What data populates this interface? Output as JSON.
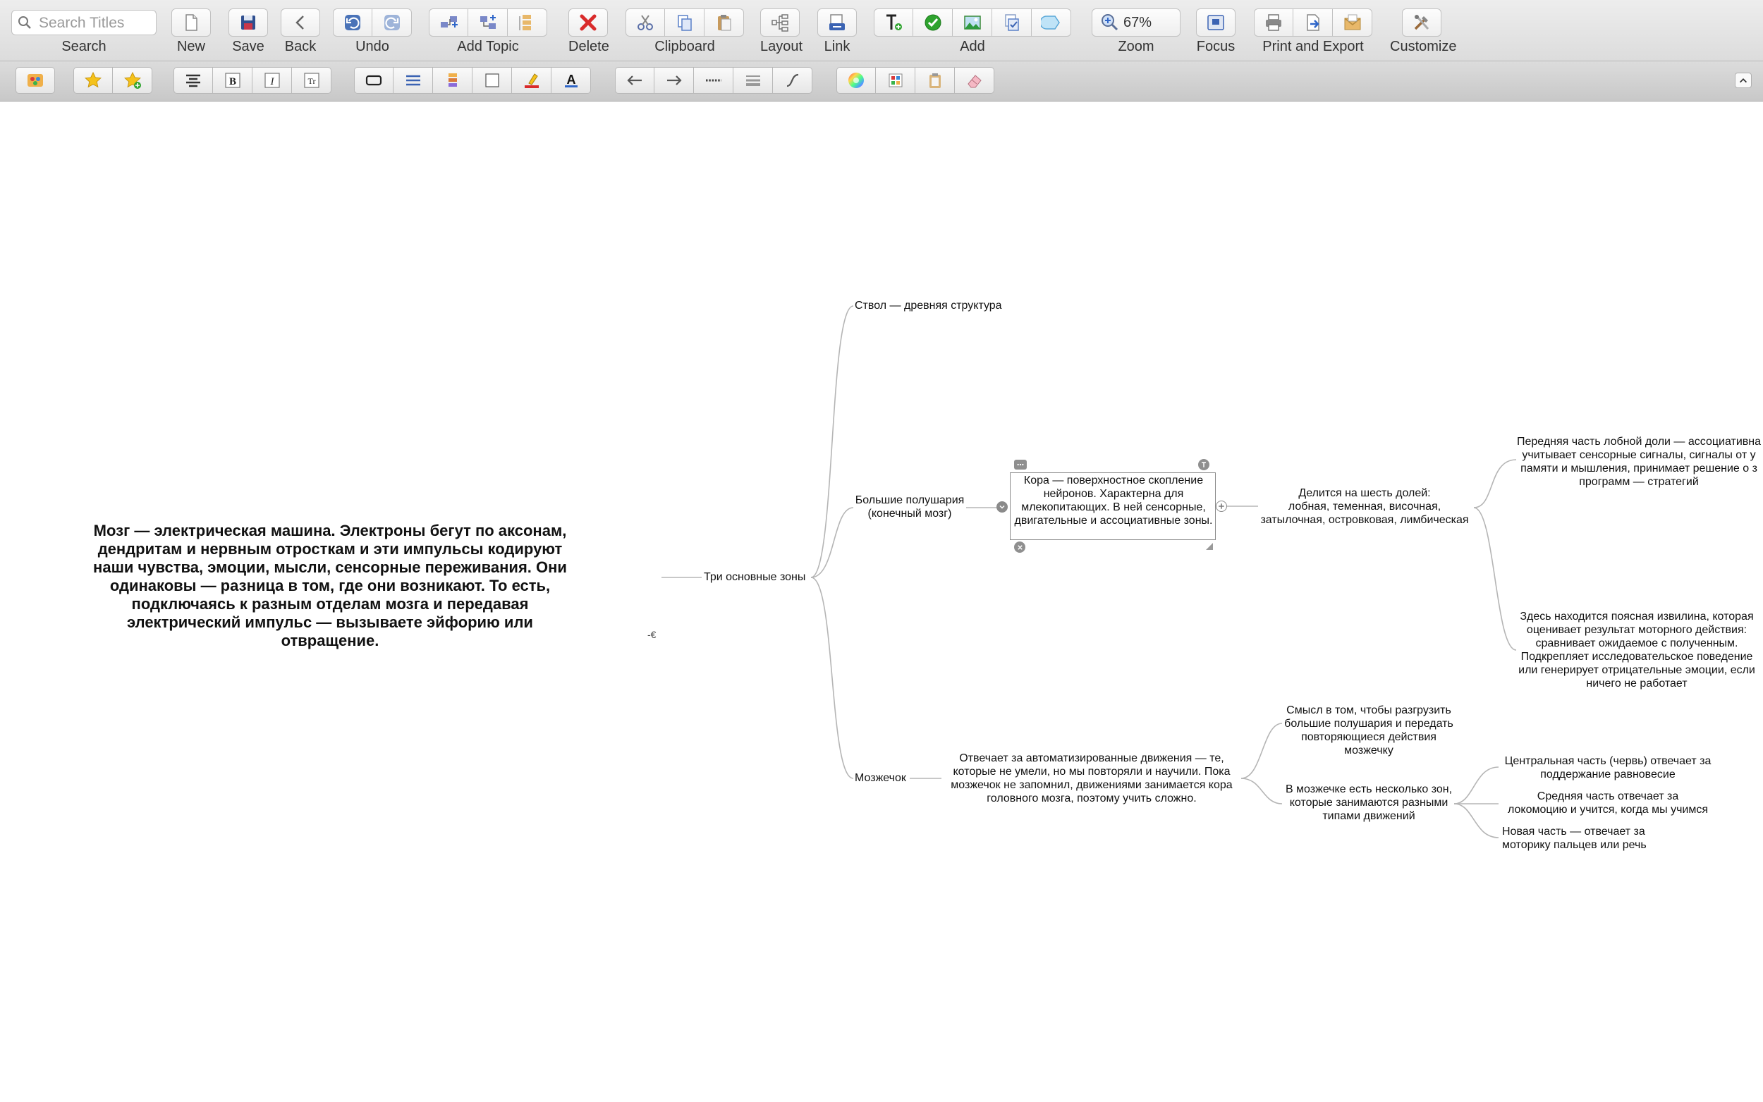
{
  "toolbar": {
    "search_placeholder": "Search Titles",
    "labels": {
      "search": "Search",
      "new": "New",
      "save": "Save",
      "back": "Back",
      "undo": "Undo",
      "add_topic": "Add Topic",
      "delete": "Delete",
      "clipboard": "Clipboard",
      "layout": "Layout",
      "link": "Link",
      "add": "Add",
      "zoom": "Zoom",
      "focus": "Focus",
      "print_export": "Print and Export",
      "customize": "Customize"
    },
    "zoom_value": "67%"
  },
  "colors": {
    "accent_blue": "#2f66c9",
    "delete_red": "#d92b2b",
    "check_green": "#2ea32e"
  },
  "map": {
    "central": "Мозг — электрическая машина. Электроны бегут по аксонам, дендритам и нервным отросткам и эти импульсы кодируют наши чувства, эмоции, мысли, сенсорные переживания. Они одинаковы — разница в том, где они возникают. То есть, подключаясь к разным отделам мозга и передавая электрический импульс — вызываете эйфорию или отвращение.",
    "zones": "Три основные зоны",
    "stem": "Ствол — древняя структура",
    "hemispheres": "Большие полушария\n(конечный мозг)",
    "cortex": "Кора — поверхностное скопление нейронов. Характерна для млекопитающих. В ней сенсорные, двигательные и ассоциативные зоны.",
    "lobes": "Делится на шесть долей:\nлобная, теменная, височная,\nзатылочная, островковая, лимбическая",
    "frontal": "Передняя часть лобной доли — ассоциативна\nучитывает сенсорные сигналы, сигналы от у\nпамяти и мышления, принимает решение о з\nпрограмм — стратегий",
    "cingulate": "Здесь находится поясная извилина, которая\nоценивает результат моторного действия:\nсравнивает ожидаемое с полученным.\nПодкрепляет исследовательское поведение\nили генерирует отрицательные эмоции, если\nничего не работает",
    "cerebellum": "Мозжечок",
    "cerebellum_desc": "Отвечает за автоматизированные движения — те,\nкоторые не умели, но мы повторяли и научили. Пока\nмозжечок не запомнил, движениями занимается кора\nголовного мозга, поэтому учить сложно.",
    "unload": "Смысл в том, чтобы разгрузить\nбольшие полушария и передать\nповторяющиеся действия мозжечку",
    "zones_cb": "В мозжечке есть несколько зон,\nкоторые занимаются разными\nтипами движений",
    "vermis": "Центральная часть (червь) отвечает за\nподдержание равновесие",
    "middle": "Средняя часть отвечает за\nлокомоцию и учится, когда мы учимся",
    "new_part": "Новая часть — отвечает за\nмоторику пальцев или речь"
  }
}
